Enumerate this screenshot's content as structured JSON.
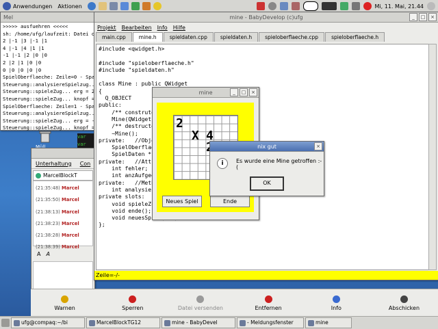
{
  "top_panel": {
    "menu_apps": "Anwendungen",
    "menu_actions": "Aktionen",
    "clock": "Mi, 11. Mai, 21.44"
  },
  "terminal": {
    "title": "Mel",
    "lines": [
      ">>>>> ausfuehren <<<<<",
      "sh: /home/ufg/laufzeit: Datei oder V",
      "2 |-1 |3 |-1 |1",
      "4 |-1 |4 |1 |1",
      "-1 |-1 |2 |0 |0",
      "2 |2 |1 |0 |0",
      "0 |0 |0 |0 |0",
      "SpielOberflaeche: Zeile=0 - Spalte",
      "Steuerung::analysiereSpielzug... x",
      "Steuerung::spieleZug... erg = 2",
      "Steuerung::spieleZug... knopf = 1",
      "SpielOberflaeche: Zeile=1 - Spalte",
      "Steuerung::analysiereSpielzug... x",
      "Steuerung::spieleZug... erg = -1",
      "Steuerung::spieleZug... knopf = 1"
    ]
  },
  "green_console": {
    "lines": [
      "var",
      "var",
      "Aus",
      "Aus",
      "ret",
      "Scri",
      "ferti",
      "ferti",
      "run-",
      "ferti",
      "run-",
      "for",
      "for",
      "Scri",
      "run-",
      "ferti"
    ]
  },
  "chat": {
    "menu_label": "Unterhaltung",
    "menu_label2": "Con",
    "tab_label": "MarcelBlockT",
    "messages": [
      {
        "time": "(21:35:48)",
        "name": "Marcel"
      },
      {
        "time": "(21:35:50)",
        "name": "Marcel"
      },
      {
        "time": "(21:38:13)",
        "name": "Marcel"
      },
      {
        "time": "(21:38:23)",
        "name": "Marcel"
      },
      {
        "time": "(21:38:28)",
        "name": "Marcel"
      },
      {
        "time": "(21:38:39)",
        "name": "Marcel"
      }
    ],
    "format_a1": "A",
    "format_a2": "A"
  },
  "editor": {
    "title": "mine - BabyDevelop (c)ufg",
    "menu": [
      "Projekt",
      "Bearbeiten",
      "Info",
      "Hilfe"
    ],
    "tabs": [
      "main.cpp",
      "mine.h",
      "spieldaten.cpp",
      "spieldaten.h",
      "spieloberflaeche.cpp",
      "spieloberflaeche.h"
    ],
    "selected_tab": "mine.h",
    "code_lines": [
      "#include <qwidget.h>",
      "",
      "#include \"spieloberflaeche.h\"",
      "#include \"spieldaten.h\"",
      "",
      "class Mine : public QWidget",
      "{",
      "  Q_OBJECT",
      "public:",
      "    /** construte",
      "    Mine(QWidget",
      "    /** destructo",
      "    ~Mine();",
      "private:   //Obje",
      "    SpielOberflae",
      "    SpielDaten *so",
      "private:   //Attr",
      "    int fehler;",
      "    int anzAufgede",
      "private:   //Meth",
      "    int analysiere",
      "private slots:",
      "    void spieleZug",
      "    void ende();",
      "    void neuesSpiel(int);",
      "};"
    ],
    "status": "Zeile=-/-"
  },
  "mine_window": {
    "title": "mine",
    "grid_text": [
      "2",
      "X",
      "4",
      "2"
    ],
    "new_game": "Neues Spiel",
    "end": "Ende"
  },
  "dialog": {
    "title": "nix gut",
    "icon_glyph": "i",
    "message": "Es wurde eine Mine getroffen :-(",
    "ok": "OK"
  },
  "bottom_toolbar": {
    "buttons": [
      {
        "label": "Warnen",
        "color": "#d9a400"
      },
      {
        "label": "Sperren",
        "color": "#cc2020"
      },
      {
        "label": "Datei versenden",
        "color": "#9a9a9a"
      },
      {
        "label": "Entfernen",
        "color": "#cc2020"
      },
      {
        "label": "Info",
        "color": "#3a6ad0"
      },
      {
        "label": "Abschicken",
        "color": "#444444"
      }
    ]
  },
  "taskbar": {
    "items": [
      "ufg@compaq:~/bi",
      "MarcelBlockTG12",
      "mine - BabyDevel",
      "- Meldungsfenster",
      "mine"
    ]
  },
  "desktop_icon_label": "Müll"
}
